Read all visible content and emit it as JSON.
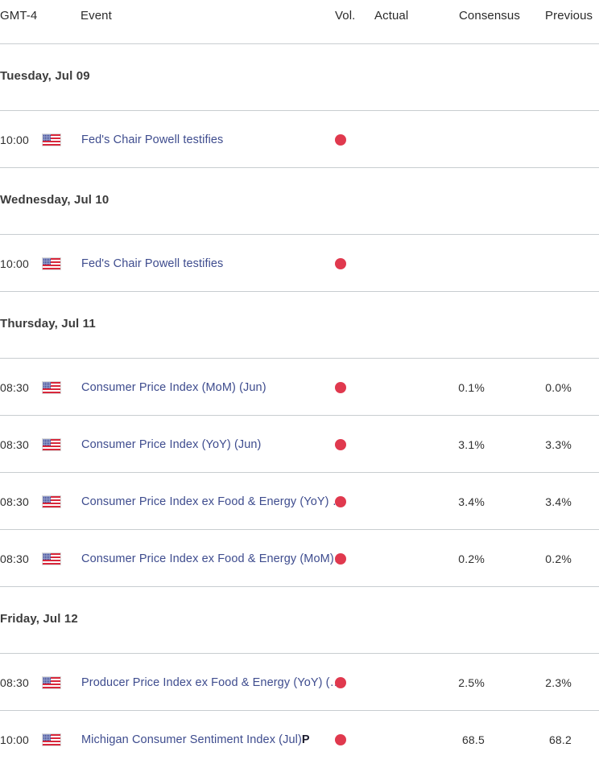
{
  "header": {
    "timezone": "GMT-4",
    "event": "Event",
    "vol": "Vol.",
    "actual": "Actual",
    "consensus": "Consensus",
    "previous": "Previous"
  },
  "colors": {
    "link": "#3e4c8e",
    "volatility_high": "#e0394e",
    "divider": "#c8cdd0",
    "day_header_text": "#3c3c3c"
  },
  "sections": [
    {
      "date_label": "Tuesday, Jul 09",
      "rows": [
        {
          "time": "10:00",
          "country_icon": "us-flag-icon",
          "event": "Fed's Chair Powell testifies",
          "event_bold_tail": "",
          "volatility_icon": "volatility-dot-high",
          "actual": "",
          "consensus": "",
          "previous": ""
        }
      ]
    },
    {
      "date_label": "Wednesday, Jul 10",
      "rows": [
        {
          "time": "10:00",
          "country_icon": "us-flag-icon",
          "event": "Fed's Chair Powell testifies",
          "event_bold_tail": "",
          "volatility_icon": "volatility-dot-high",
          "actual": "",
          "consensus": "",
          "previous": ""
        }
      ]
    },
    {
      "date_label": "Thursday, Jul 11",
      "rows": [
        {
          "time": "08:30",
          "country_icon": "us-flag-icon",
          "event": "Consumer Price Index (MoM) (Jun)",
          "event_bold_tail": "",
          "volatility_icon": "volatility-dot-high",
          "actual": "",
          "consensus": "0.1%",
          "previous": "0.0%"
        },
        {
          "time": "08:30",
          "country_icon": "us-flag-icon",
          "event": "Consumer Price Index (YoY) (Jun)",
          "event_bold_tail": "",
          "volatility_icon": "volatility-dot-high",
          "actual": "",
          "consensus": "3.1%",
          "previous": "3.3%"
        },
        {
          "time": "08:30",
          "country_icon": "us-flag-icon",
          "event": "Consumer Price Index ex Food & Energy (YoY) (Jun)",
          "event_bold_tail": "",
          "volatility_icon": "volatility-dot-high",
          "actual": "",
          "consensus": "3.4%",
          "previous": "3.4%"
        },
        {
          "time": "08:30",
          "country_icon": "us-flag-icon",
          "event": "Consumer Price Index ex Food & Energy (MoM) (Jun)",
          "event_bold_tail": "",
          "volatility_icon": "volatility-dot-high",
          "actual": "",
          "consensus": "0.2%",
          "previous": "0.2%"
        }
      ]
    },
    {
      "date_label": "Friday, Jul 12",
      "rows": [
        {
          "time": "08:30",
          "country_icon": "us-flag-icon",
          "event": "Producer Price Index ex Food & Energy (YoY) (Jun)",
          "event_bold_tail": "",
          "volatility_icon": "volatility-dot-high",
          "actual": "",
          "consensus": "2.5%",
          "previous": "2.3%"
        },
        {
          "time": "10:00",
          "country_icon": "us-flag-icon",
          "event": "Michigan Consumer Sentiment Index (Jul)",
          "event_bold_tail": "P",
          "volatility_icon": "volatility-dot-high",
          "actual": "",
          "consensus": "68.5",
          "previous": "68.2"
        }
      ]
    }
  ]
}
